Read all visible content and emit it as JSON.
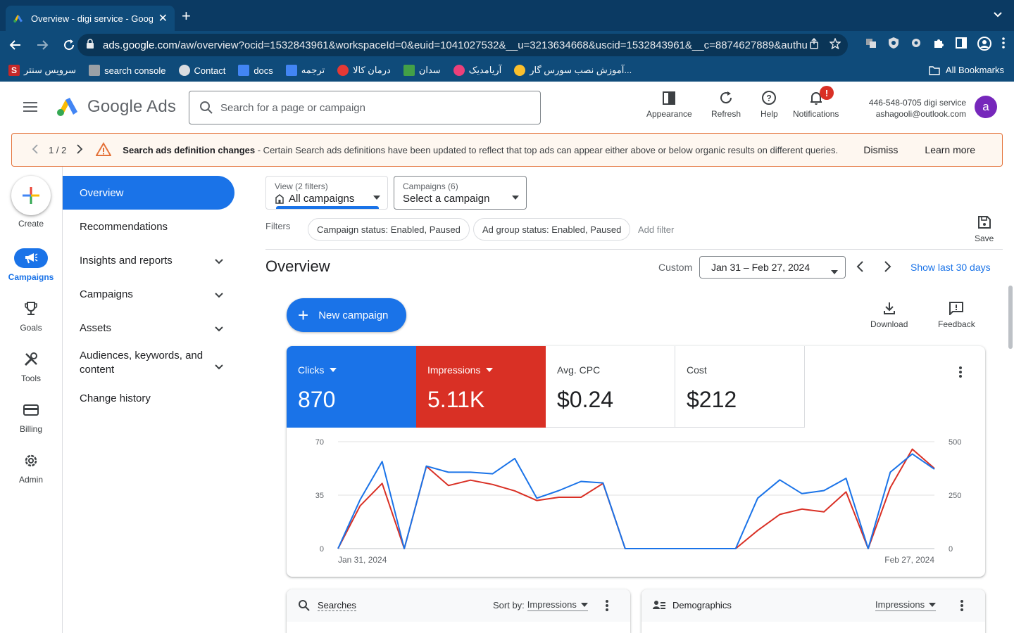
{
  "browser": {
    "tab_title": "Overview - digi service - Goog",
    "url_host": "ads.google.com",
    "url_path": "/aw/overview?ocid=1532843961&workspaceId=0&euid=1041027532&__u=3213634668&uscid=1532843961&__c=8874627889&authu...",
    "bookmarks": [
      "سرویس سنتر",
      "search console",
      "Contact",
      "docs",
      "ترجمه",
      "درمان کالا",
      "سدان",
      "آریامدیک",
      "آموزش نصب سورس گار..."
    ],
    "all_bookmarks": "All Bookmarks"
  },
  "header": {
    "product_name": "Google Ads",
    "search_placeholder": "Search for a page or campaign",
    "buttons": {
      "appearance": "Appearance",
      "refresh": "Refresh",
      "help": "Help",
      "notifications": "Notifications"
    },
    "notification_badge": "!",
    "account_line1": "446-548-0705 digi service",
    "account_line2": "ashagooli@outlook.com",
    "avatar_letter": "a"
  },
  "banner": {
    "pager": "1 / 2",
    "title": "Search ads definition changes",
    "message": " - Certain Search ads definitions have been updated to reflect that top ads can appear either above or below organic results on different queries.",
    "dismiss": "Dismiss",
    "learn_more": "Learn more"
  },
  "rail": {
    "create": "Create",
    "campaigns": "Campaigns",
    "goals": "Goals",
    "tools": "Tools",
    "billing": "Billing",
    "admin": "Admin"
  },
  "sidenav": {
    "overview": "Overview",
    "recommendations": "Recommendations",
    "insights": "Insights and reports",
    "campaigns": "Campaigns",
    "assets": "Assets",
    "audiences": "Audiences, keywords, and content",
    "change_history": "Change history"
  },
  "main": {
    "view_small": "View (2 filters)",
    "view_big": "All campaigns",
    "campaigns_small": "Campaigns (6)",
    "campaigns_big": "Select a campaign",
    "filters_label": "Filters",
    "chip1": "Campaign status: Enabled, Paused",
    "chip2": "Ad group status: Enabled, Paused",
    "add_filter": "Add filter",
    "save": "Save",
    "title": "Overview",
    "custom": "Custom",
    "date_range": "Jan 31 – Feb 27, 2024",
    "show_last": "Show last 30 days",
    "new_campaign": "New campaign",
    "download": "Download",
    "feedback": "Feedback"
  },
  "metrics": [
    {
      "name": "Clicks",
      "value": "870"
    },
    {
      "name": "Impressions",
      "value": "5.11K"
    },
    {
      "name": "Avg. CPC",
      "value": "$0.24"
    },
    {
      "name": "Cost",
      "value": "$212"
    }
  ],
  "bottom": {
    "searches": "Searches",
    "sort_by": "Sort by:",
    "searches_sort": "Impressions",
    "demographics": "Demographics",
    "demographics_sort": "Impressions"
  },
  "colors": {
    "clicks": "#1a73e8",
    "impressions": "#d93025"
  },
  "chart_data": {
    "type": "line",
    "x": [
      "Jan 31, 2024",
      "Feb 1, 2024",
      "Feb 2, 2024",
      "Feb 3, 2024",
      "Feb 4, 2024",
      "Feb 5, 2024",
      "Feb 6, 2024",
      "Feb 7, 2024",
      "Feb 8, 2024",
      "Feb 9, 2024",
      "Feb 10, 2024",
      "Feb 11, 2024",
      "Feb 12, 2024",
      "Feb 13, 2024",
      "Feb 14, 2024",
      "Feb 15, 2024",
      "Feb 16, 2024",
      "Feb 17, 2024",
      "Feb 18, 2024",
      "Feb 19, 2024",
      "Feb 20, 2024",
      "Feb 21, 2024",
      "Feb 22, 2024",
      "Feb 23, 2024",
      "Feb 24, 2024",
      "Feb 25, 2024",
      "Feb 26, 2024",
      "Feb 27, 2024"
    ],
    "x_tick_labels": [
      "Jan 31, 2024",
      "Feb 27, 2024"
    ],
    "series": [
      {
        "name": "Clicks",
        "axis": "left",
        "color": "#1a73e8",
        "values": [
          0,
          32,
          57,
          0,
          54,
          50,
          50,
          49,
          59,
          33,
          38,
          44,
          43,
          0,
          0,
          0,
          0,
          0,
          0,
          33,
          45,
          36,
          38,
          46,
          0,
          50,
          62,
          52
        ]
      },
      {
        "name": "Impressions",
        "axis": "right",
        "color": "#d93025",
        "values": [
          0,
          200,
          305,
          0,
          385,
          295,
          320,
          300,
          270,
          225,
          240,
          240,
          305,
          0,
          0,
          0,
          0,
          0,
          0,
          85,
          160,
          185,
          172,
          265,
          0,
          285,
          465,
          375
        ]
      }
    ],
    "y_left_ticks": [
      0,
      35,
      70
    ],
    "y_right_ticks": [
      0,
      250,
      500
    ],
    "ylim_left": [
      0,
      70
    ],
    "ylim_right": [
      0,
      500
    ],
    "grid": true
  }
}
